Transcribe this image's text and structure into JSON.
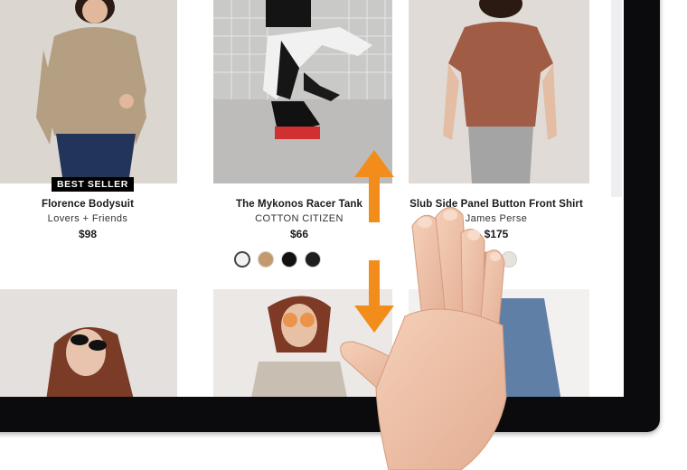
{
  "products": [
    {
      "name": "Florence Bodysuit",
      "brand": "Lovers + Friends",
      "price": "$98",
      "badge": "BEST SELLER",
      "swatches": []
    },
    {
      "name": "The Mykonos Racer Tank",
      "brand": "COTTON CITIZEN",
      "price": "$66",
      "badge": "",
      "swatches": [
        "#f4f2f0",
        "#c49a6c",
        "#121212",
        "#1e1e1e"
      ]
    },
    {
      "name": "Slub Side Panel Button Front Shirt",
      "brand": "James Perse",
      "price": "$175",
      "badge": "",
      "swatches": [
        "#c9a982",
        "#e7e2dc"
      ]
    }
  ],
  "gesture": {
    "hint": "two-finger-swipe-vertical",
    "arrow_color": "#f28c1b"
  }
}
